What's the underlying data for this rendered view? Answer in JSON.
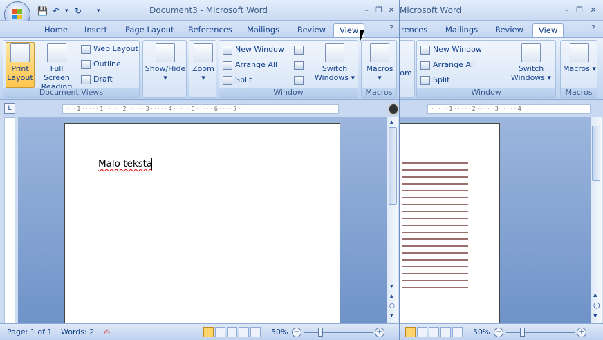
{
  "foreground_window": {
    "title": "Document3 - Microsoft Word",
    "tabs": [
      {
        "label": "Home"
      },
      {
        "label": "Insert"
      },
      {
        "label": "Page Layout"
      },
      {
        "label": "References"
      },
      {
        "label": "Mailings"
      },
      {
        "label": "Review"
      },
      {
        "label": "View"
      }
    ],
    "active_tab": "View",
    "groups": {
      "document_views": {
        "label": "Document Views",
        "print_layout": [
          "Print",
          "Layout"
        ],
        "full_screen_reading": [
          "Full Screen",
          "Reading"
        ],
        "web_layout": "Web Layout",
        "outline": "Outline",
        "draft": "Draft"
      },
      "show_hide": {
        "label": "Show/Hide"
      },
      "zoom": {
        "label": "Zoom"
      },
      "window": {
        "label": "Window",
        "new_window": "New Window",
        "arrange_all": "Arrange All",
        "split": "Split",
        "switch_windows": [
          "Switch",
          "Windows"
        ]
      },
      "macros": {
        "label": "Macros",
        "button": "Macros"
      }
    },
    "document_text": "Malo teksta",
    "status": {
      "page": "Page: 1 of 1",
      "words": "Words: 2",
      "zoom": "50%"
    }
  },
  "background_window": {
    "title": "Microsoft Word",
    "tabs": [
      {
        "label": "rences"
      },
      {
        "label": "Mailings"
      },
      {
        "label": "Review"
      },
      {
        "label": "View"
      }
    ],
    "active_tab": "View",
    "groups": {
      "zoom_partial": "om",
      "window": {
        "label": "Window",
        "new_window": "New Window",
        "arrange_all": "Arrange All",
        "split": "Split",
        "switch_windows": [
          "Switch",
          "Windows"
        ]
      },
      "macros": {
        "label": "Macros",
        "button": "Macros"
      }
    },
    "status": {
      "zoom": "50%"
    }
  },
  "icons": [
    "office-button-icon",
    "save-icon",
    "undo-icon",
    "redo-icon",
    "customize-qat-icon",
    "minimize-icon",
    "restore-icon",
    "close-icon",
    "help-icon",
    "ruler-toggle-icon",
    "scroll-up-icon",
    "scroll-down-icon",
    "prev-page-icon",
    "select-browse-object-icon",
    "next-page-icon",
    "proofing-icon",
    "zoom-out-icon",
    "zoom-in-icon",
    "split-handle-icon"
  ],
  "colors": {
    "accent": "#15428b",
    "active_view": "#ffd46b"
  }
}
